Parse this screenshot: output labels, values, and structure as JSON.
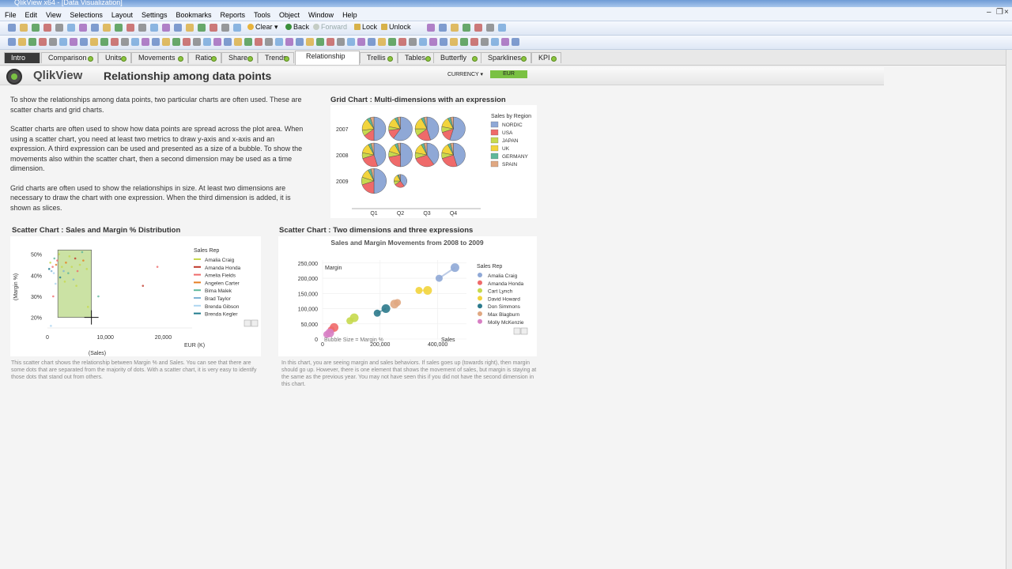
{
  "window": {
    "title": "QlikView x64 - [Data Visualization]"
  },
  "menu": [
    "File",
    "Edit",
    "View",
    "Selections",
    "Layout",
    "Settings",
    "Bookmarks",
    "Reports",
    "Tools",
    "Object",
    "Window",
    "Help"
  ],
  "toolbar": {
    "clear": "Clear",
    "back": "Back",
    "forward": "Forward",
    "lock": "Lock",
    "unlock": "Unlock"
  },
  "tabs": [
    {
      "label": "Intro"
    },
    {
      "label": "Comparison"
    },
    {
      "label": "Units"
    },
    {
      "label": "Movements"
    },
    {
      "label": "Ratio"
    },
    {
      "label": "Share"
    },
    {
      "label": "Trends"
    },
    {
      "label": "Relationship"
    },
    {
      "label": "Trellis"
    },
    {
      "label": "Tables"
    },
    {
      "label": "Butterfly"
    },
    {
      "label": "Sparklines"
    },
    {
      "label": "KPI"
    }
  ],
  "header": {
    "brand": "QlikView",
    "title": "Relationship among data points",
    "currency_label": "CURRENCY",
    "currency_value": "EUR"
  },
  "intro": [
    "To show the relationships among data points, two particular charts are often used. These are scatter charts and grid charts.",
    "Scatter charts are often used to show how data points are spread across the plot area. When using a scatter chart, you need at least two metrics to draw y-axis and x-axis and an expression. A third expression can be used and presented as a size of a bubble. To show the movements also within the scatter chart, then a second dimension may be used as a time dimension.",
    "Grid charts are often used to show the relationships in size. At least two dimensions are necessary to draw the chart with one expression. When the third dimension is added, it is shown as slices."
  ],
  "grid_section_title": "Grid Chart : Multi-dimensions with an expression",
  "scatter1_section_title": "Scatter Chart : Sales and Margin % Distribution",
  "scatter2_section_title": "Scatter Chart : Two dimensions and three expressions",
  "scatter1_caption": "This scatter chart shows the relationship between Margin % and Sales. You can see that there are some dots that are separated from the majority of dots. With a scatter chart, it is very easy to identify those dots that stand out from others.",
  "scatter2_caption": "In this chart, you are seeing margin and sales behaviors. If sales goes up (towards right), then margin should go up. However, there is one element that shows the movement of sales, but margin is staying at the same as the previous year. You may not have seen this if you did not have the second dimension in this chart.",
  "colors": {
    "nordic": "#8fa8d6",
    "usa": "#ef6a6a",
    "japan": "#c7d94e",
    "uk": "#f2d43c",
    "germany": "#5fb89a",
    "spain": "#e0a882",
    "accent": "#7ac143"
  },
  "chart_data": [
    {
      "type": "pie-grid",
      "title": "",
      "x_categories": [
        "Q1",
        "Q2",
        "Q3",
        "Q4"
      ],
      "y_categories": [
        "2007",
        "2008",
        "2009"
      ],
      "legend_title": "Sales by Region",
      "legend": [
        "NORDIC",
        "USA",
        "JAPAN",
        "UK",
        "GERMANY",
        "SPAIN"
      ],
      "cells": [
        {
          "x": "Q1",
          "y": "2007",
          "size": 1.0,
          "shares": [
            0.5,
            0.15,
            0.08,
            0.17,
            0.05,
            0.05
          ]
        },
        {
          "x": "Q2",
          "y": "2007",
          "size": 1.0,
          "shares": [
            0.6,
            0.13,
            0.05,
            0.14,
            0.04,
            0.04
          ]
        },
        {
          "x": "Q3",
          "y": "2007",
          "size": 1.0,
          "shares": [
            0.45,
            0.2,
            0.1,
            0.17,
            0.04,
            0.04
          ]
        },
        {
          "x": "Q4",
          "y": "2007",
          "size": 1.0,
          "shares": [
            0.55,
            0.15,
            0.08,
            0.14,
            0.04,
            0.04
          ]
        },
        {
          "x": "Q1",
          "y": "2008",
          "size": 1.0,
          "shares": [
            0.45,
            0.25,
            0.08,
            0.14,
            0.04,
            0.04
          ]
        },
        {
          "x": "Q2",
          "y": "2008",
          "size": 1.0,
          "shares": [
            0.5,
            0.22,
            0.08,
            0.12,
            0.04,
            0.04
          ]
        },
        {
          "x": "Q3",
          "y": "2008",
          "size": 1.0,
          "shares": [
            0.4,
            0.3,
            0.08,
            0.14,
            0.04,
            0.04
          ]
        },
        {
          "x": "Q4",
          "y": "2008",
          "size": 1.0,
          "shares": [
            0.45,
            0.25,
            0.08,
            0.14,
            0.04,
            0.04
          ]
        },
        {
          "x": "Q1",
          "y": "2009",
          "size": 1.05,
          "shares": [
            0.5,
            0.2,
            0.1,
            0.12,
            0.04,
            0.04
          ]
        },
        {
          "x": "Q2",
          "y": "2009",
          "size": 0.55,
          "shares": [
            0.4,
            0.25,
            0.1,
            0.17,
            0.04,
            0.04
          ]
        }
      ]
    },
    {
      "type": "scatter",
      "xlabel": "(Sales)",
      "xunit": "EUR (K)",
      "ylabel": "(Margin %)",
      "xlim": [
        0,
        25000
      ],
      "ylim": [
        15,
        54
      ],
      "xticks": [
        {
          "v": 0,
          "label": "0"
        },
        {
          "v": 10000,
          "label": "10,000"
        },
        {
          "v": 20000,
          "label": "20,000"
        }
      ],
      "yticks": [
        {
          "v": 50,
          "label": "50%"
        },
        {
          "v": 40,
          "label": "40%"
        },
        {
          "v": 30,
          "label": "30%"
        },
        {
          "v": 20,
          "label": "20%"
        }
      ],
      "legend_title": "Sales Rep",
      "legend": [
        {
          "name": "Amalia Craig",
          "color": "#c7d94e"
        },
        {
          "name": "Amanda Honda",
          "color": "#c0392b"
        },
        {
          "name": "Amelia Fields",
          "color": "#ef6a6a"
        },
        {
          "name": "Angelen Carter",
          "color": "#e67e22"
        },
        {
          "name": "Bima Malek",
          "color": "#5fb89a"
        },
        {
          "name": "Brad Taylor",
          "color": "#7fb3d5"
        },
        {
          "name": "Brenda Gibson",
          "color": "#aed6f1"
        },
        {
          "name": "Brenda Kegler",
          "color": "#1f7a8c"
        }
      ],
      "selection": {
        "x0": 1800,
        "x1": 7600,
        "y0": 20,
        "y1": 52
      },
      "points": [
        {
          "x": 500,
          "y": 46,
          "c": 0
        },
        {
          "x": 900,
          "y": 44,
          "c": 2
        },
        {
          "x": 1200,
          "y": 48,
          "c": 4
        },
        {
          "x": 700,
          "y": 42,
          "c": 5
        },
        {
          "x": 1500,
          "y": 45,
          "c": 3
        },
        {
          "x": 2000,
          "y": 50,
          "c": 0
        },
        {
          "x": 1100,
          "y": 41,
          "c": 6
        },
        {
          "x": 300,
          "y": 43,
          "c": 7
        },
        {
          "x": 1700,
          "y": 47,
          "c": 2
        },
        {
          "x": 2500,
          "y": 44,
          "c": 0
        },
        {
          "x": 3200,
          "y": 46,
          "c": 3
        },
        {
          "x": 2800,
          "y": 42,
          "c": 5
        },
        {
          "x": 4200,
          "y": 44,
          "c": 0
        },
        {
          "x": 3600,
          "y": 41,
          "c": 4
        },
        {
          "x": 4800,
          "y": 48,
          "c": 1
        },
        {
          "x": 5600,
          "y": 45,
          "c": 0
        },
        {
          "x": 5200,
          "y": 42,
          "c": 2
        },
        {
          "x": 6200,
          "y": 47,
          "c": 3
        },
        {
          "x": 6800,
          "y": 43,
          "c": 0
        },
        {
          "x": 4500,
          "y": 38,
          "c": 5
        },
        {
          "x": 2200,
          "y": 39,
          "c": 7
        },
        {
          "x": 3000,
          "y": 37,
          "c": 0
        },
        {
          "x": 1400,
          "y": 36,
          "c": 6
        },
        {
          "x": 5000,
          "y": 35,
          "c": 0
        },
        {
          "x": 7000,
          "y": 25,
          "c": 0
        },
        {
          "x": 8800,
          "y": 30,
          "c": 4
        },
        {
          "x": 600,
          "y": 16,
          "c": 6
        },
        {
          "x": 1000,
          "y": 30,
          "c": 2
        },
        {
          "x": 16500,
          "y": 35,
          "c": 1
        },
        {
          "x": 19000,
          "y": 44,
          "c": 2
        },
        {
          "x": 3800,
          "y": 49,
          "c": 0
        },
        {
          "x": 6000,
          "y": 51,
          "c": 4
        }
      ]
    },
    {
      "type": "scatter",
      "title": "Sales and Margin Movements from 2008 to 2009",
      "xlabel": "Sales",
      "ylabel": "Margin",
      "xlim": [
        0,
        500000
      ],
      "ylim": [
        0,
        260000
      ],
      "xticks": [
        {
          "v": 0,
          "label": "0"
        },
        {
          "v": 200000,
          "label": "200,000"
        },
        {
          "v": 400000,
          "label": "400,000"
        }
      ],
      "yticks": [
        {
          "v": 250000,
          "label": "250,000"
        },
        {
          "v": 200000,
          "label": "200,000"
        },
        {
          "v": 150000,
          "label": "150,000"
        },
        {
          "v": 100000,
          "label": "100,000"
        },
        {
          "v": 50000,
          "label": "50,000"
        },
        {
          "v": 0,
          "label": "0"
        }
      ],
      "bubble_note": "Bubble Size = Margin %",
      "legend_title": "Sales Rep",
      "legend": [
        {
          "name": "Amalia Craig",
          "color": "#8fa8d6"
        },
        {
          "name": "Amanda Honda",
          "color": "#ef6a6a"
        },
        {
          "name": "Cart Lynch",
          "color": "#c7d94e"
        },
        {
          "name": "David Howard",
          "color": "#f2d43c"
        },
        {
          "name": "Don Simmons",
          "color": "#2c7a8c"
        },
        {
          "name": "Max Blagburn",
          "color": "#e0a882"
        },
        {
          "name": "Molly McKenzie",
          "color": "#d77fc4"
        }
      ],
      "series": [
        {
          "c": 0,
          "points": [
            {
              "x": 405000,
              "y": 200000
            },
            {
              "x": 460000,
              "y": 235000
            }
          ]
        },
        {
          "c": 1,
          "points": [
            {
              "x": 30000,
              "y": 30000
            },
            {
              "x": 40000,
              "y": 38000
            }
          ]
        },
        {
          "c": 2,
          "points": [
            {
              "x": 95000,
              "y": 60000
            },
            {
              "x": 110000,
              "y": 70000
            }
          ]
        },
        {
          "c": 3,
          "points": [
            {
              "x": 335000,
              "y": 160000
            },
            {
              "x": 365000,
              "y": 160000
            }
          ]
        },
        {
          "c": 4,
          "points": [
            {
              "x": 190000,
              "y": 85000
            },
            {
              "x": 220000,
              "y": 100000
            }
          ]
        },
        {
          "c": 5,
          "points": [
            {
              "x": 260000,
              "y": 120000
            },
            {
              "x": 250000,
              "y": 115000
            }
          ]
        },
        {
          "c": 6,
          "points": [
            {
              "x": 15000,
              "y": 15000
            },
            {
              "x": 25000,
              "y": 20000
            }
          ]
        }
      ]
    }
  ]
}
